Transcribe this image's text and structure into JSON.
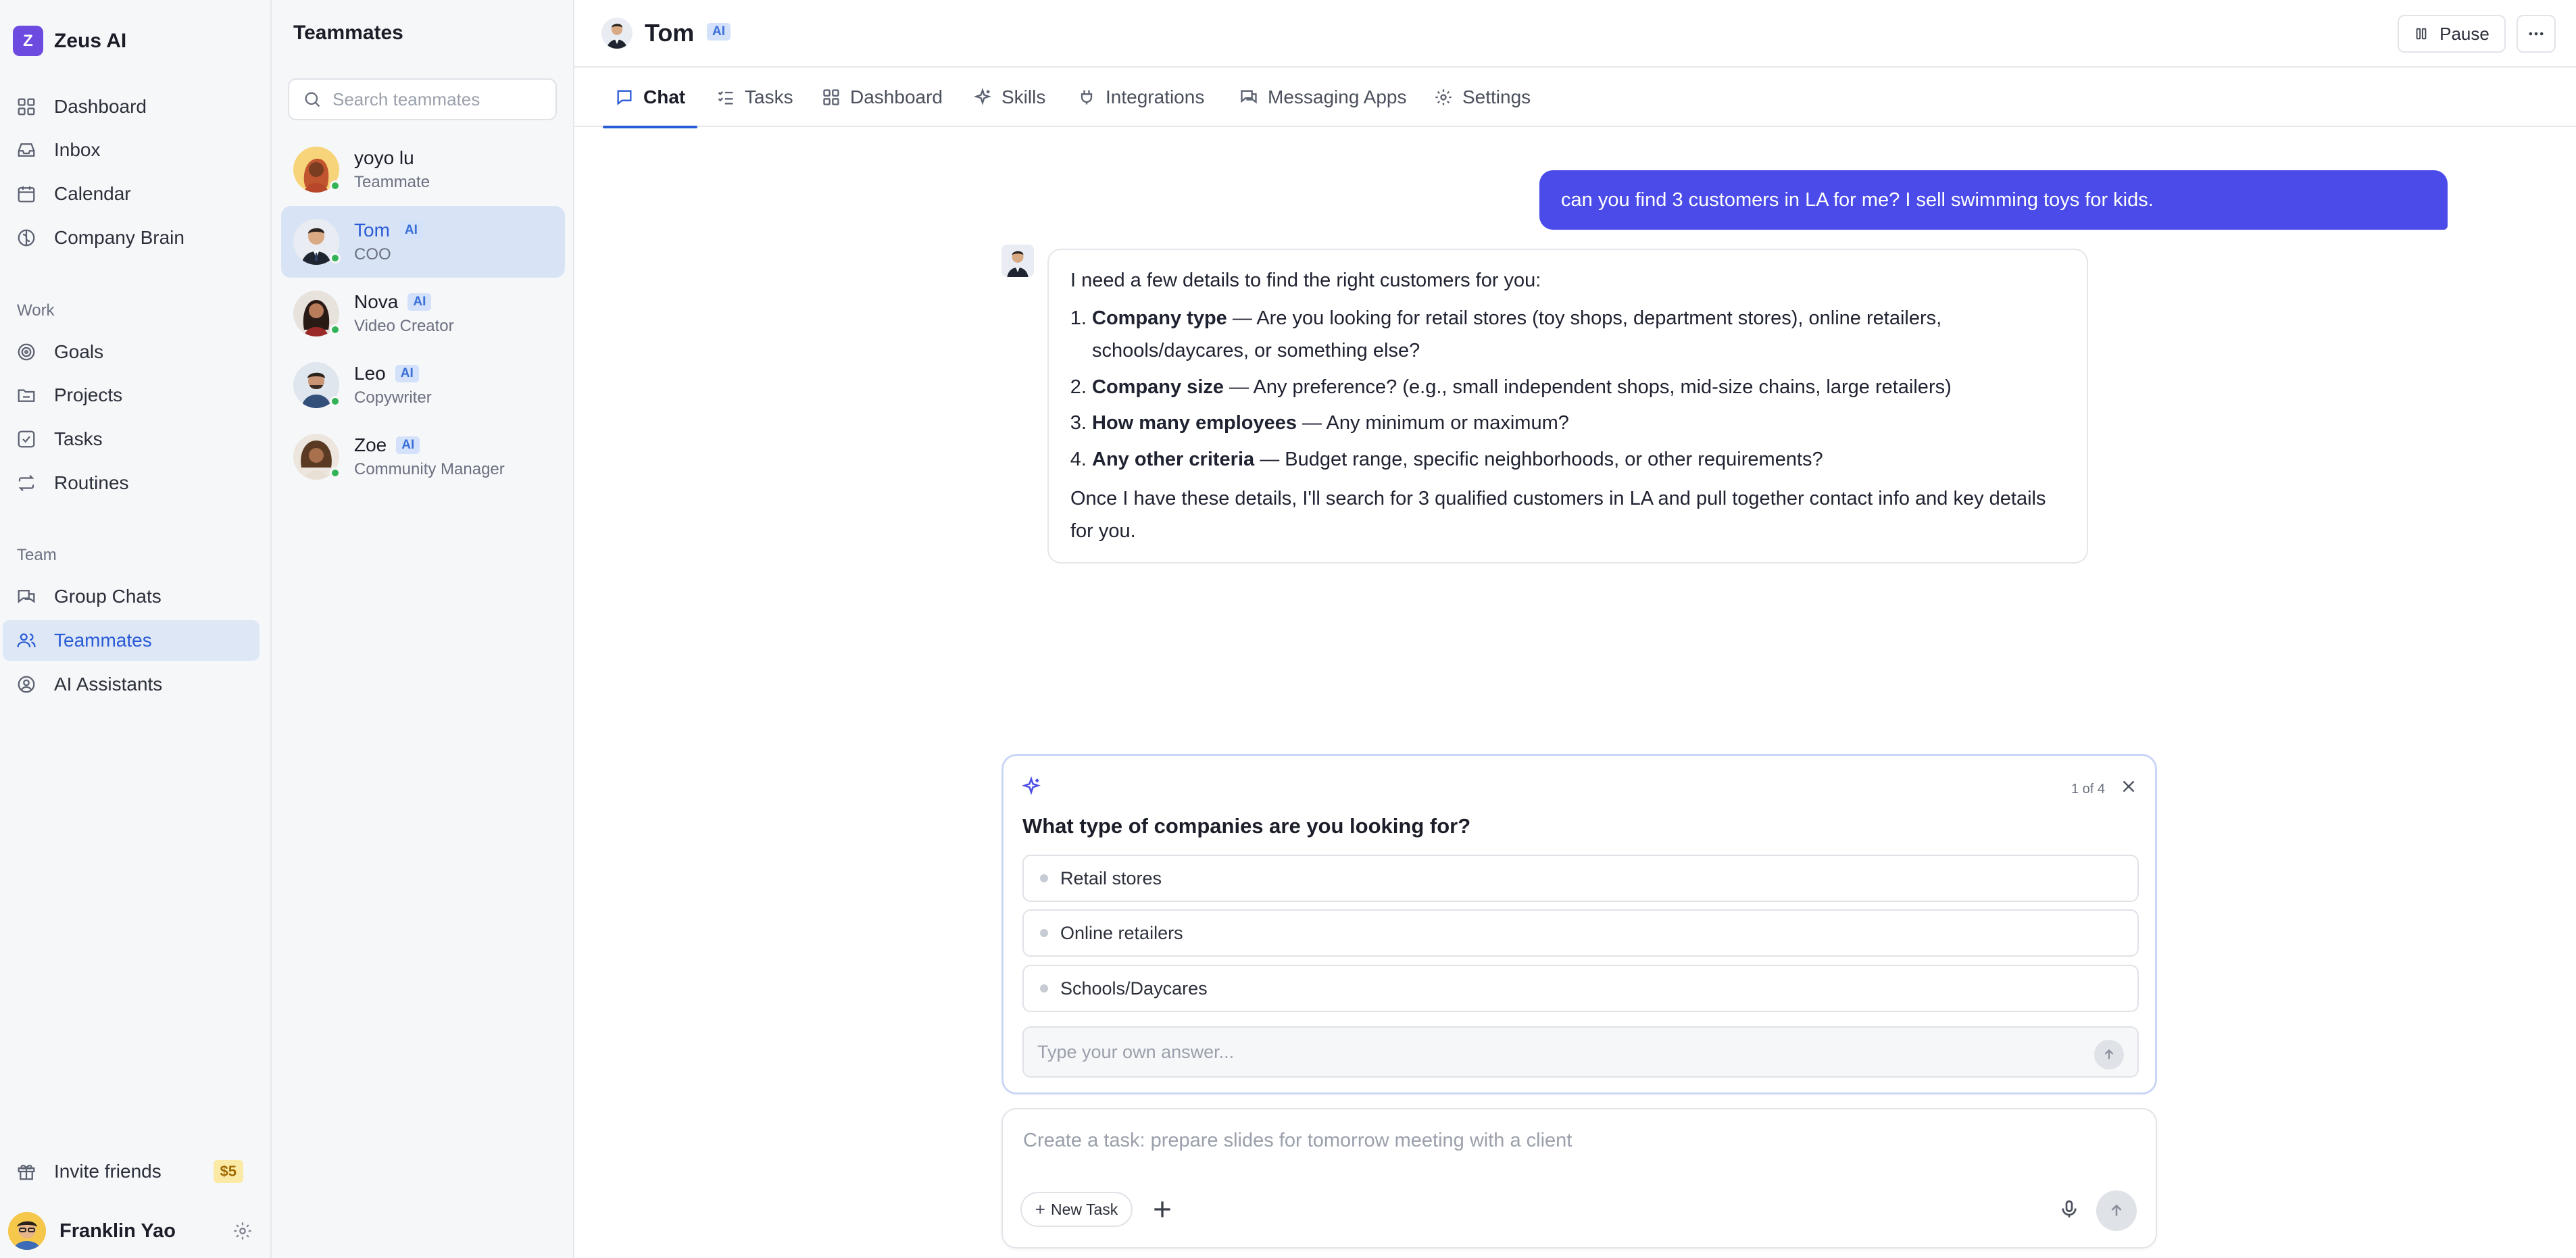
{
  "app": {
    "name": "Zeus AI",
    "logo_letter": "Z",
    "accent": "#6d4ae0",
    "link_blue": "#2a5bd7"
  },
  "sidebar": {
    "main_items": [
      {
        "label": "Dashboard",
        "icon": "grid-icon"
      },
      {
        "label": "Inbox",
        "icon": "inbox-icon"
      },
      {
        "label": "Calendar",
        "icon": "calendar-icon"
      },
      {
        "label": "Company Brain",
        "icon": "brain-icon"
      }
    ],
    "work_label": "Work",
    "work_items": [
      {
        "label": "Goals",
        "icon": "target-icon"
      },
      {
        "label": "Projects",
        "icon": "folder-icon"
      },
      {
        "label": "Tasks",
        "icon": "checkbox-icon"
      },
      {
        "label": "Routines",
        "icon": "repeat-icon"
      }
    ],
    "team_label": "Team",
    "team_items": [
      {
        "label": "Group Chats",
        "icon": "chat-icon"
      },
      {
        "label": "Teammates",
        "icon": "users-icon",
        "active": true
      },
      {
        "label": "AI Assistants",
        "icon": "bot-icon"
      }
    ],
    "invite": {
      "label": "Invite friends",
      "badge": "$5"
    },
    "user": {
      "name": "Franklin Yao"
    }
  },
  "teammates": {
    "title": "Teammates",
    "search_placeholder": "Search teammates",
    "list": [
      {
        "name": "yoyo lu",
        "role": "Teammate",
        "ai": false
      },
      {
        "name": "Tom",
        "role": "COO",
        "ai": true,
        "active": true
      },
      {
        "name": "Nova",
        "role": "Video Creator",
        "ai": true
      },
      {
        "name": "Leo",
        "role": "Copywriter",
        "ai": true
      },
      {
        "name": "Zoe",
        "role": "Community Manager",
        "ai": true
      }
    ],
    "ai_badge": "AI"
  },
  "header": {
    "name": "Tom",
    "badge": "AI",
    "pause_label": "Pause",
    "tabs": [
      {
        "label": "Chat",
        "icon": "chat-bubble-icon",
        "active": true
      },
      {
        "label": "Tasks",
        "icon": "list-check-icon"
      },
      {
        "label": "Dashboard",
        "icon": "grid-icon"
      },
      {
        "label": "Skills",
        "icon": "sparkles-icon"
      },
      {
        "label": "Integrations",
        "icon": "plug-icon"
      },
      {
        "label": "Messaging Apps",
        "icon": "messages-icon"
      },
      {
        "label": "Settings",
        "icon": "gear-icon"
      }
    ]
  },
  "chat": {
    "user_message": "can you find 3 customers in LA for me? I sell swimming toys for kids.",
    "assistant": {
      "intro": "I need a few details to find the right customers for you:",
      "items": [
        {
          "bold": "Company type",
          "text": " — Are you looking for retail stores (toy shops, department stores), online retailers, schools/daycares, or something else?"
        },
        {
          "bold": "Company size",
          "text": " — Any preference? (e.g., small independent shops, mid-size chains, large retailers)"
        },
        {
          "bold": "How many employees",
          "text": " — Any minimum or maximum?"
        },
        {
          "bold": "Any other criteria",
          "text": " — Budget range, specific neighborhoods, or other requirements?"
        }
      ],
      "outro": "Once I have these details, I'll search for 3 qualified customers in LA and pull together contact info and key details for you."
    }
  },
  "question": {
    "counter": "1 of 4",
    "title": "What type of companies are you looking for?",
    "options": [
      "Retail stores",
      "Online retailers",
      "Schools/Daycares"
    ],
    "input_placeholder": "Type your own answer..."
  },
  "composer": {
    "placeholder": "Create a task: prepare slides for tomorrow meeting with a client",
    "new_task_label": "New Task"
  }
}
